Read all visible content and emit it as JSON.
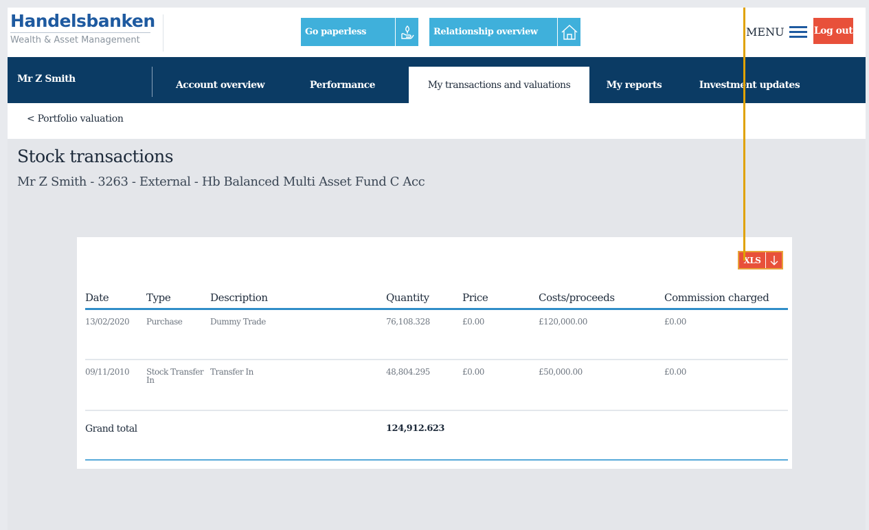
{
  "brand": {
    "name": "Handelsbanken",
    "subtitle": "Wealth & Asset Management"
  },
  "header": {
    "go_paperless": "Go paperless",
    "relationship_overview": "Relationship overview",
    "menu_label": "MENU",
    "logout_label": "Log out",
    "paperless_icon": "hand-leaf-icon",
    "relationship_icon": "house-icon"
  },
  "nav": {
    "user": "Mr Z Smith",
    "tabs": [
      {
        "label": "Account overview",
        "active": false
      },
      {
        "label": "Performance",
        "active": false
      },
      {
        "label": "My transactions and valuations",
        "active": true
      },
      {
        "label": "My reports",
        "active": false
      },
      {
        "label": "Investment updates",
        "active": false
      }
    ]
  },
  "subnav": {
    "back_link": "< Portfolio valuation"
  },
  "page": {
    "title": "Stock transactions",
    "subtitle": "Mr Z Smith - 3263 - External - Hb Balanced Multi Asset Fund C Acc"
  },
  "export": {
    "label": "XLS",
    "icon": "download-arrow-icon"
  },
  "table": {
    "headers": [
      "Date",
      "Type",
      "Description",
      "Quantity",
      "Price",
      "Costs/proceeds",
      "Commission charged"
    ],
    "rows": [
      [
        "13/02/2020",
        "Purchase",
        "Dummy Trade",
        "76,108.328",
        "£0.00",
        "£120,000.00",
        "£0.00"
      ],
      [
        "09/11/2010",
        "Stock Transfer In",
        "Transfer In",
        "48,804.295",
        "£0.00",
        "£50,000.00",
        "£0.00"
      ]
    ],
    "total_label": "Grand total",
    "total_quantity": "124,912.623"
  },
  "colors": {
    "brand_blue": "#1e5aa0",
    "nav_bg": "#0b3b64",
    "accent_cyan": "#3fb0db",
    "logout_red": "#e8503a",
    "callout": "#e0a200"
  }
}
